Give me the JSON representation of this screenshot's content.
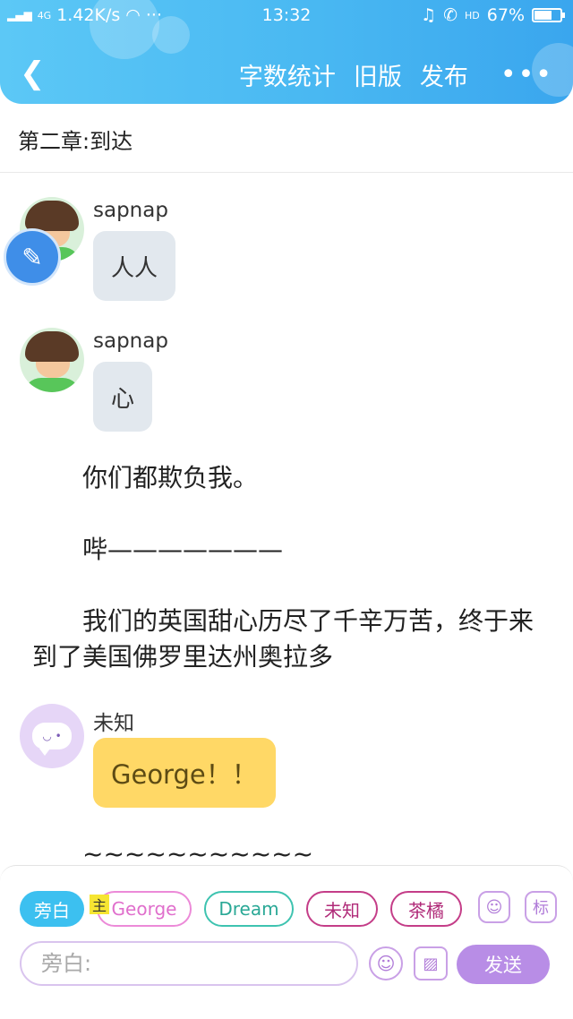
{
  "status_bar": {
    "network": "4G",
    "speed": "1.42K/s",
    "time": "13:32",
    "hd": "HD",
    "battery": "67%",
    "battery_level": 0.67
  },
  "nav": {
    "word_count": "字数统计",
    "old_version": "旧版",
    "publish": "发布"
  },
  "chapter_title": "第二章:到达",
  "messages": [
    {
      "sender": "sapnap",
      "text": "人人",
      "style": "grey"
    },
    {
      "sender": "sapnap",
      "text": "心",
      "style": "grey"
    },
    {
      "sender": "未知",
      "text": "George！！",
      "style": "yellow"
    }
  ],
  "narration": [
    "你们都欺负我。",
    "哔———————",
    "我们的英国甜心历尽了千辛万苦，终于来到了美国佛罗里达州奥拉多",
    "~~~~~~~~~~~~"
  ],
  "roles": {
    "narrator": "旁白",
    "main_tag": "主",
    "george": "George",
    "dream": "Dream",
    "weizhi": "未知",
    "chaju": "茶橘",
    "tag_btn": "标"
  },
  "input": {
    "placeholder": "旁白:",
    "send": "发送"
  },
  "colors": {
    "header_gradient_start": "#5cc8f6",
    "header_gradient_end": "#3aa6ee",
    "send_button": "#b88de6",
    "active_role": "#3cc0f0",
    "yellow_bubble": "#ffd866"
  },
  "icons": {
    "back": "back-arrow-icon",
    "more": "more-dots-icon",
    "emoji": "emoji-icon",
    "image": "image-icon",
    "character": "character-icon",
    "floating_tool": "floating-tool-icon"
  }
}
